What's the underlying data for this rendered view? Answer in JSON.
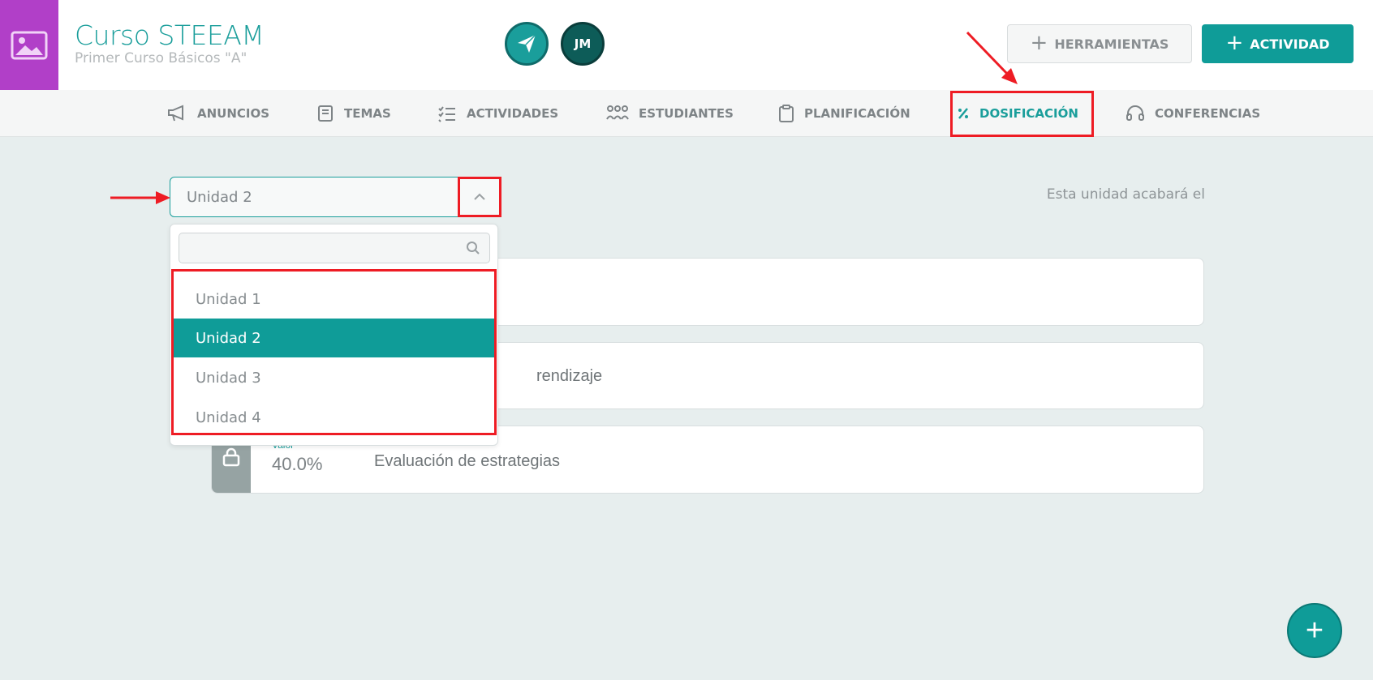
{
  "course": {
    "title": "Curso STEEAM",
    "subtitle": "Primer Curso Básicos \"A\"",
    "avatar_initials": "JM"
  },
  "toolbar": {
    "tools_label": "HERRAMIENTAS",
    "activity_label": "ACTIVIDAD"
  },
  "nav": {
    "items": [
      {
        "label": "ANUNCIOS",
        "icon": "megaphone-icon"
      },
      {
        "label": "TEMAS",
        "icon": "book-icon"
      },
      {
        "label": "ACTIVIDADES",
        "icon": "checklist-icon"
      },
      {
        "label": "ESTUDIANTES",
        "icon": "group-icon"
      },
      {
        "label": "PLANIFICACIÓN",
        "icon": "clipboard-icon"
      },
      {
        "label": "DOSIFICACIÓN",
        "icon": "percent-icon",
        "active": true
      },
      {
        "label": "CONFERENCIAS",
        "icon": "headset-icon"
      }
    ]
  },
  "unit_selector": {
    "selected": "Unidad 2",
    "search_placeholder": "",
    "options": [
      "Unidad 1",
      "Unidad 2",
      "Unidad 3",
      "Unidad 4"
    ]
  },
  "unit_end_text": "Esta unidad acabará el",
  "cards": [
    {
      "partial_text": ""
    },
    {
      "partial_text": "rendizaje"
    },
    {
      "label": "Valor",
      "value": "40.0%",
      "text": "Evaluación de estrategias"
    }
  ],
  "colors": {
    "primary": "#0f9c98",
    "course_image": "#b13fc8",
    "annotation": "#ee1c24"
  }
}
